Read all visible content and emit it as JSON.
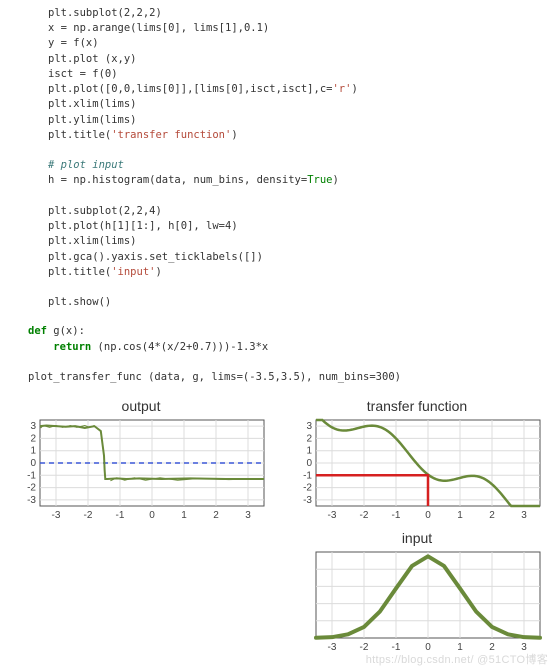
{
  "code_lines": [
    [
      [
        "plain",
        "plt.subplot(2,2,2)"
      ]
    ],
    [
      [
        "plain",
        "x = np.arange(lims[0], lims[1],0.1)"
      ]
    ],
    [
      [
        "plain",
        "y = f(x)"
      ]
    ],
    [
      [
        "plain",
        "plt.plot (x,y)"
      ]
    ],
    [
      [
        "plain",
        "isct = f(0)"
      ]
    ],
    [
      [
        "plain",
        "plt.plot([0,0,lims[0]],[lims[0],isct,isct],c="
      ],
      [
        "str",
        "'r'"
      ],
      [
        "plain",
        ")"
      ]
    ],
    [
      [
        "plain",
        "plt.xlim(lims)"
      ]
    ],
    [
      [
        "plain",
        "plt.ylim(lims)"
      ]
    ],
    [
      [
        "plain",
        "plt.title("
      ],
      [
        "str",
        "'transfer function'"
      ],
      [
        "plain",
        ")"
      ]
    ],
    [
      [
        "plain",
        ""
      ]
    ],
    [
      [
        "cmt",
        "# plot input"
      ]
    ],
    [
      [
        "plain",
        "h = np.histogram(data, num_bins, density="
      ],
      [
        "builtin",
        "True"
      ],
      [
        "plain",
        ")"
      ]
    ],
    [
      [
        "plain",
        ""
      ]
    ],
    [
      [
        "plain",
        "plt.subplot(2,2,4)"
      ]
    ],
    [
      [
        "plain",
        "plt.plot(h[1][1:], h[0], lw=4)"
      ]
    ],
    [
      [
        "plain",
        "plt.xlim(lims)"
      ]
    ],
    [
      [
        "plain",
        "plt.gca().yaxis.set_ticklabels([])"
      ]
    ],
    [
      [
        "plain",
        "plt.title("
      ],
      [
        "str",
        "'input'"
      ],
      [
        "plain",
        ")"
      ]
    ],
    [
      [
        "plain",
        ""
      ]
    ],
    [
      [
        "plain",
        "plt.show()"
      ]
    ]
  ],
  "code_block2_lines": [
    [
      [
        "kw",
        "def"
      ],
      [
        "plain",
        " g(x):"
      ]
    ],
    [
      [
        "plain",
        "    "
      ],
      [
        "kw",
        "return"
      ],
      [
        "plain",
        " (np.cos(4*(x/2+0.7)))-1.3*x"
      ]
    ],
    [
      [
        "plain",
        ""
      ]
    ],
    [
      [
        "plain",
        "plot_transfer_func (data, g, lims=(-3.5,3.5), num_bins=300)"
      ]
    ]
  ],
  "chart_data": [
    {
      "id": "output",
      "type": "line",
      "title": "output",
      "xlim": [
        -3.5,
        3.5
      ],
      "ylim": [
        -3.5,
        3.5
      ],
      "xticks": [
        -3,
        -2,
        -1,
        0,
        1,
        2,
        3
      ],
      "yticks": [
        -3,
        -2,
        -1,
        0,
        1,
        2,
        3
      ],
      "hline_dashed": {
        "y": 0,
        "color": "#3a57d6"
      },
      "series": [
        {
          "name": "output-spread",
          "color": "#6a8a3a",
          "lw": 2,
          "points": [
            [
              -3.5,
              3.0
            ],
            [
              -3.3,
              3.05
            ],
            [
              -3.0,
              3.0
            ],
            [
              -2.7,
              2.95
            ],
            [
              -2.4,
              3.0
            ],
            [
              -2.1,
              2.85
            ],
            [
              -1.8,
              3.0
            ],
            [
              -1.6,
              2.6
            ],
            [
              -1.5,
              0.6
            ],
            [
              -1.48,
              -0.6
            ],
            [
              -1.46,
              -1.3
            ],
            [
              -1.4,
              -1.3
            ],
            [
              -1.1,
              -1.25
            ],
            [
              -0.8,
              -1.3
            ],
            [
              -0.4,
              -1.25
            ],
            [
              0.3,
              -1.3
            ],
            [
              1.2,
              -1.25
            ],
            [
              2.3,
              -1.3
            ],
            [
              3.5,
              -1.3
            ]
          ]
        },
        {
          "name": "output-upper-ticks",
          "color": "#6a8a3a",
          "lw": 1,
          "points": [
            [
              -3.48,
              2.85
            ],
            [
              -3.4,
              3.05
            ],
            [
              -3.2,
              2.9
            ],
            [
              -3.0,
              3.05
            ],
            [
              -2.8,
              2.9
            ],
            [
              -2.55,
              3.05
            ],
            [
              -2.35,
              2.9
            ],
            [
              -2.1,
              3.05
            ],
            [
              -1.95,
              2.9
            ],
            [
              -1.8,
              3.05
            ]
          ]
        },
        {
          "name": "output-lower-ticks",
          "color": "#6a8a3a",
          "lw": 1,
          "points": [
            [
              -1.3,
              -1.45
            ],
            [
              -1.1,
              -1.2
            ],
            [
              -0.85,
              -1.4
            ],
            [
              -0.55,
              -1.2
            ],
            [
              -0.2,
              -1.4
            ],
            [
              0.25,
              -1.2
            ],
            [
              0.8,
              -1.4
            ],
            [
              1.5,
              -1.25
            ],
            [
              2.4,
              -1.35
            ],
            [
              3.4,
              -1.28
            ]
          ]
        }
      ]
    },
    {
      "id": "transfer",
      "type": "line",
      "title": "transfer function",
      "xlim": [
        -3.5,
        3.5
      ],
      "ylim": [
        -3.5,
        3.5
      ],
      "xticks": [
        -3,
        -2,
        -1,
        0,
        1,
        2,
        3
      ],
      "yticks": [
        -3,
        -2,
        -1,
        0,
        1,
        2,
        3
      ],
      "intercept_marker": {
        "x0": -3.5,
        "y": -1.0,
        "x": 0,
        "color": "#d62020"
      },
      "series": [
        {
          "name": "g(x)",
          "color": "#6a8a3a",
          "lw": 2.5,
          "fn": "g",
          "points_sample_note": "g(x)=cos(4*(x/2+0.7))-1.3x over [-3.5,3.5]"
        }
      ]
    },
    {
      "id": "input",
      "type": "line",
      "title": "input",
      "xlim": [
        -3.5,
        3.5
      ],
      "ylim": [
        0,
        0.42
      ],
      "xticks": [
        -3,
        -2,
        -1,
        0,
        1,
        2,
        3
      ],
      "yticks_hidden": true,
      "series": [
        {
          "name": "hist-density",
          "color": "#6a8a3a",
          "lw": 4,
          "points": [
            [
              -3.5,
              0.001
            ],
            [
              -3.0,
              0.004
            ],
            [
              -2.5,
              0.018
            ],
            [
              -2.0,
              0.054
            ],
            [
              -1.5,
              0.13
            ],
            [
              -1.0,
              0.242
            ],
            [
              -0.5,
              0.352
            ],
            [
              0.0,
              0.399
            ],
            [
              0.5,
              0.352
            ],
            [
              1.0,
              0.242
            ],
            [
              1.5,
              0.13
            ],
            [
              2.0,
              0.054
            ],
            [
              2.5,
              0.018
            ],
            [
              3.0,
              0.004
            ],
            [
              3.5,
              0.001
            ]
          ]
        }
      ]
    }
  ],
  "watermark": "https://blog.csdn.net/  @51CTO博客",
  "colors": {
    "grid": "#dcdcdc",
    "axis": "#555555",
    "curve_green": "#6a8a3a",
    "marker_red": "#d62020",
    "dashed_blue": "#3a57d6"
  }
}
